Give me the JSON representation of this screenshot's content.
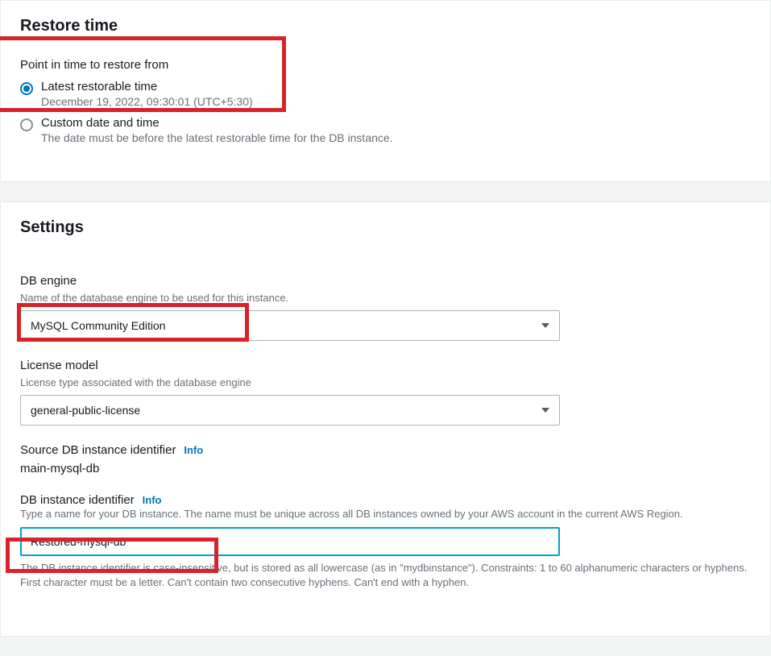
{
  "restore": {
    "heading": "Restore time",
    "point_in_time_label": "Point in time to restore from",
    "latest": {
      "label": "Latest restorable time",
      "timestamp": "December 19, 2022, 09:30:01 (UTC+5:30)"
    },
    "custom": {
      "label": "Custom date and time",
      "help": "The date must be before the latest restorable time for the DB instance."
    }
  },
  "settings": {
    "heading": "Settings",
    "db_engine": {
      "label": "DB engine",
      "help": "Name of the database engine to be used for this instance.",
      "value": "MySQL Community Edition"
    },
    "license_model": {
      "label": "License model",
      "help": "License type associated with the database engine",
      "value": "general-public-license"
    },
    "source_identifier": {
      "label": "Source DB instance identifier",
      "info": "Info",
      "value": "main-mysql-db"
    },
    "db_identifier": {
      "label": "DB instance identifier",
      "info": "Info",
      "help": "Type a name for your DB instance. The name must be unique across all DB instances owned by your AWS account in the current AWS Region.",
      "value": "Restored-mysql-db",
      "constraint": "The DB instance identifier is case-insensitive, but is stored as all lowercase (as in \"mydbinstance\"). Constraints: 1 to 60 alphanumeric characters or hyphens. First character must be a letter. Can't contain two consecutive hyphens. Can't end with a hyphen."
    }
  }
}
